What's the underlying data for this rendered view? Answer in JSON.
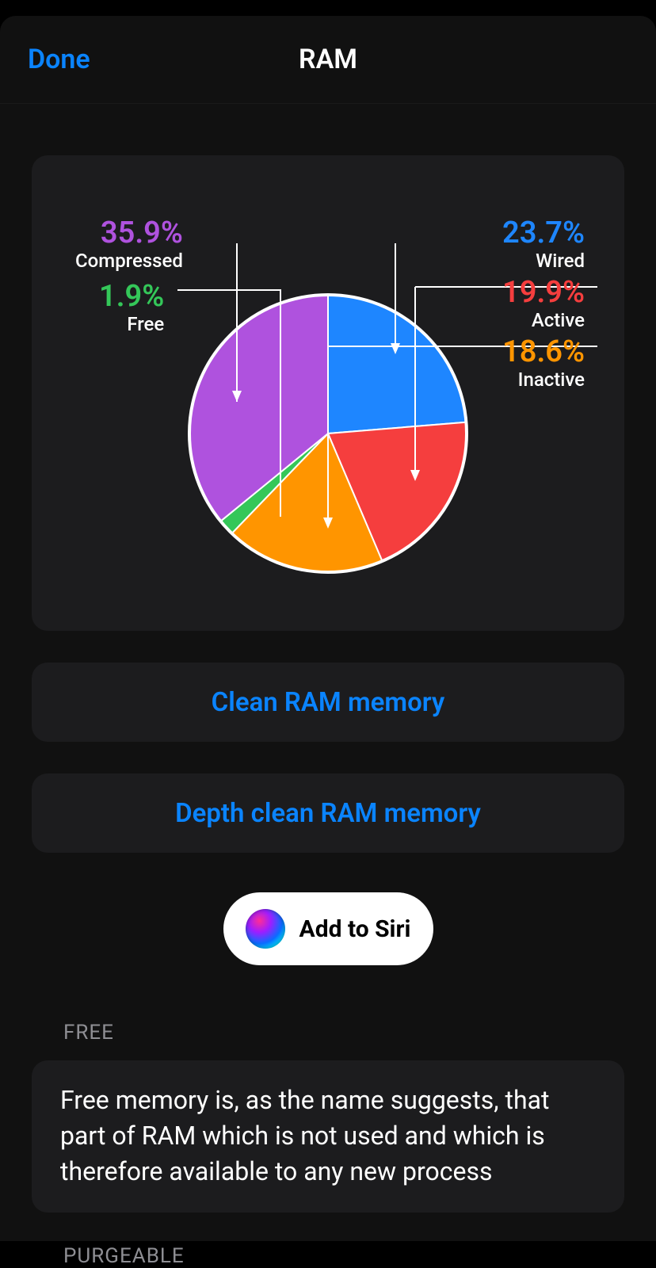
{
  "header": {
    "done": "Done",
    "title": "RAM"
  },
  "buttons": {
    "clean": "Clean RAM memory",
    "depth_clean": "Depth clean RAM memory",
    "add_to_siri": "Add to Siri"
  },
  "sections": {
    "free": {
      "header": "FREE",
      "body": "Free memory is, as the name suggests, that part of RAM which is not used and which is therefore available to any new process"
    },
    "purgeable": {
      "header": "PURGEABLE"
    }
  },
  "chart_data": {
    "type": "pie",
    "title": "RAM",
    "series": [
      {
        "name": "Wired",
        "value": 23.7,
        "color": "#1e86ff",
        "label_percent": "23.7%",
        "label_name": "Wired"
      },
      {
        "name": "Active",
        "value": 19.9,
        "color": "#f53e3e",
        "label_percent": "19.9%",
        "label_name": "Active"
      },
      {
        "name": "Inactive",
        "value": 18.6,
        "color": "#ff9500",
        "label_percent": "18.6%",
        "label_name": "Inactive"
      },
      {
        "name": "Free",
        "value": 1.9,
        "color": "#34c759",
        "label_percent": "1.9%",
        "label_name": "Free"
      },
      {
        "name": "Compressed",
        "value": 35.9,
        "color": "#af52de",
        "label_percent": "35.9%",
        "label_name": "Compressed"
      }
    ]
  }
}
